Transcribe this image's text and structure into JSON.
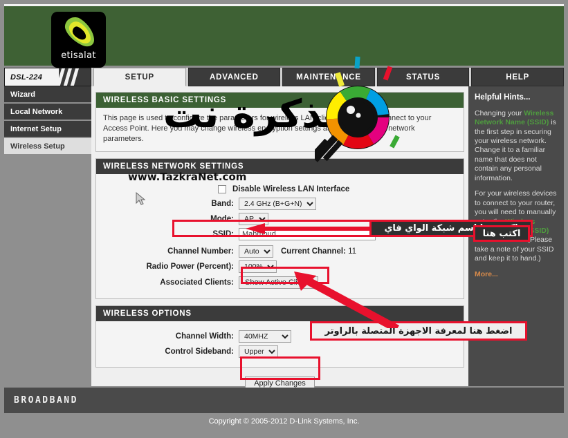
{
  "banner": {
    "brand": "etisalat"
  },
  "tabs": {
    "model": "DSL-224",
    "items": [
      {
        "label": "SETUP",
        "active": true
      },
      {
        "label": "ADVANCED",
        "active": false
      },
      {
        "label": "MAINTENANCE",
        "active": false
      },
      {
        "label": "STATUS",
        "active": false
      },
      {
        "label": "HELP",
        "active": false
      }
    ]
  },
  "sidebar": {
    "items": [
      {
        "label": "Wizard",
        "active": false
      },
      {
        "label": "Local Network",
        "active": false
      },
      {
        "label": "Internet Setup",
        "active": false
      },
      {
        "label": "Wireless Setup",
        "active": true
      }
    ]
  },
  "basic_settings": {
    "title": "WIRELESS BASIC SETTINGS",
    "description": "This page is used to configure the parameters for wireless LAN clients which may connect to your Access Point. Here you may change wireless encryption settings as well as wireless network parameters."
  },
  "network_settings": {
    "title": "WIRELESS NETWORK SETTINGS",
    "disable_label": "Disable Wireless LAN Interface",
    "disable_checked": false,
    "band_label": "Band:",
    "band_value": "2.4 GHz (B+G+N)",
    "mode_label": "Mode:",
    "mode_value": "AP",
    "ssid_label": "SSID:",
    "ssid_value": "Mahmoud",
    "channel_label": "Channel Number:",
    "channel_value": "Auto",
    "current_channel_label": "Current Channel:",
    "current_channel_value": "11",
    "radio_power_label": "Radio Power (Percent):",
    "radio_power_value": "100%",
    "associated_label": "Associated Clients:",
    "show_clients_button": "Show Active Clients"
  },
  "wireless_options": {
    "title": "WIRELESS OPTIONS",
    "channel_width_label": "Channel Width:",
    "channel_width_value": "40MHZ",
    "control_sideband_label": "Control Sideband:",
    "control_sideband_value": "Upper"
  },
  "apply": {
    "label": "Apply Changes"
  },
  "hints": {
    "title": "Helpful Hints...",
    "p1_a": "Changing your ",
    "p1_green": "Wireless Network Name (SSID)",
    "p1_b": " is the first step in securing your wireless network. Change it to a familiar name that does not contain any personal information.",
    "p2_a": "For your wireless devices to connect to your router, you will need to manually enter the ",
    "p2_green": "Wireless Network Name (SSID)",
    "p2_b": " on each device. (Please take a note of your SSID and keep it to hand.)",
    "more": "More..."
  },
  "footer": {
    "broadband": "BROADBAND",
    "copyright": "Copyright © 2005-2012 D-Link Systems, Inc."
  },
  "annotations": {
    "ssid_note": "اكتب هنا اسم شبكة الواي فاي",
    "clients_note": "اضغط هنا لمعرفة الاجهزة المتصلة بالراوتر",
    "hint_note": "اكتب هنا"
  },
  "watermark": {
    "site": "www.TazkraNet.com",
    "arabic": "تذكرة نت"
  },
  "colors": {
    "banner_green": "#3e6134",
    "panel_green": "#3c6134",
    "accent_red": "#e8112d",
    "hint_green": "#4f9c3f",
    "more_orange": "#d98b4a"
  }
}
